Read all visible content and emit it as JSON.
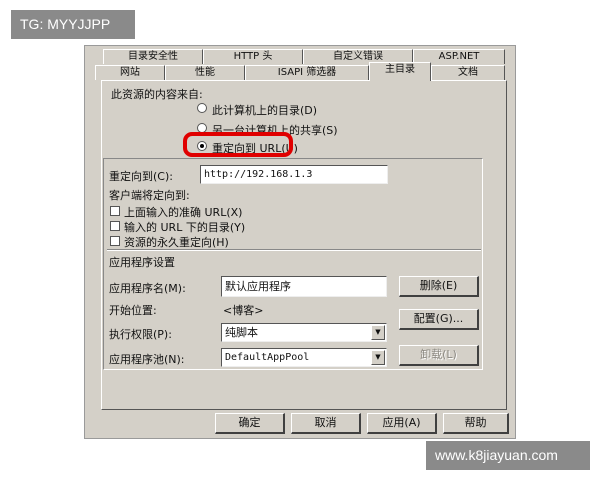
{
  "watermarks": {
    "top_left": "TG: MYYJJPP",
    "bottom_right": "www.k8jiayuan.com"
  },
  "tabs": {
    "row_back": [
      "目录安全性",
      "HTTP 头",
      "自定义错误",
      "ASP.NET"
    ],
    "row_front": [
      "网站",
      "性能",
      "ISAPI 筛选器",
      "主目录",
      "文档"
    ],
    "active": "主目录"
  },
  "source": {
    "label": "此资源的内容来自:",
    "options": [
      {
        "label": "此计算机上的目录(D)",
        "selected": false
      },
      {
        "label": "另一台计算机上的共享(S)",
        "selected": false
      },
      {
        "label": "重定向到 URL(U)",
        "selected": true
      }
    ]
  },
  "redirect": {
    "label": "重定向到(C):",
    "value": "http://192.168.1.3",
    "client_label": "客户端将定向到:",
    "checks": [
      {
        "label": "上面输入的准确 URL(X)",
        "checked": false
      },
      {
        "label": "输入的 URL 下的目录(Y)",
        "checked": false
      },
      {
        "label": "资源的永久重定向(H)",
        "checked": false
      }
    ]
  },
  "app": {
    "section_label": "应用程序设置",
    "name_label": "应用程序名(M):",
    "name_value": "默认应用程序",
    "start_label": "开始位置:",
    "start_value": "<博客>",
    "perm_label": "执行权限(P):",
    "perm_value": "纯脚本",
    "pool_label": "应用程序池(N):",
    "pool_value": "DefaultAppPool",
    "remove_btn": "删除(E)",
    "config_btn": "配置(G)...",
    "unload_btn": "卸载(L)"
  },
  "footer": {
    "ok": "确定",
    "cancel": "取消",
    "apply": "应用(A)",
    "help": "帮助"
  },
  "annotation_color": "#e00000"
}
